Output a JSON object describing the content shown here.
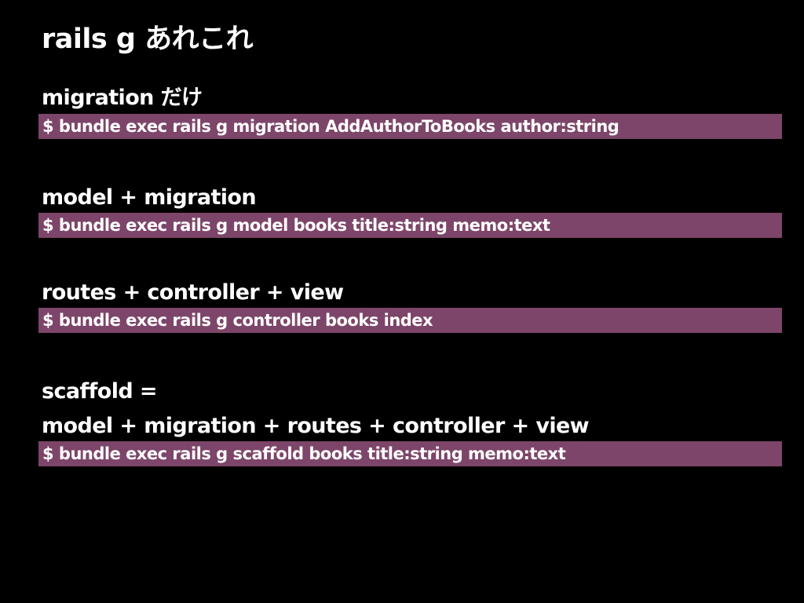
{
  "slide": {
    "title": "rails g あれこれ",
    "sections": [
      {
        "heading": "migration だけ",
        "command": "$ bundle exec rails g migration AddAuthorToBooks author:string"
      },
      {
        "heading": "model + migration",
        "command": "$ bundle exec rails g model books title:string memo:text"
      },
      {
        "heading": "routes + controller + view",
        "command": "$ bundle exec rails g controller books index"
      },
      {
        "heading_line1": "scaffold =",
        "heading_line2": "model + migration + routes + controller + view",
        "command": "$ bundle exec rails g scaffold books title:string memo:text"
      }
    ]
  },
  "colors": {
    "background": "#000000",
    "text": "#ffffff",
    "command_highlight": "#7d4569"
  }
}
